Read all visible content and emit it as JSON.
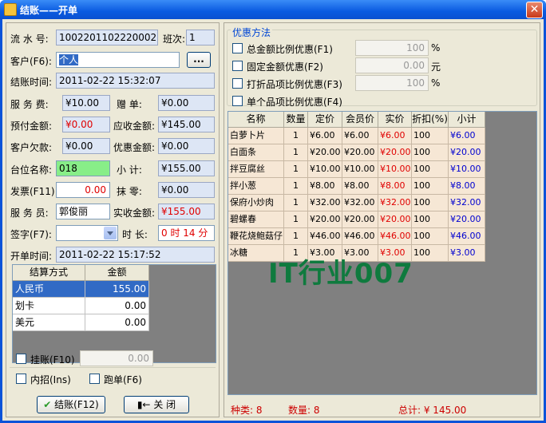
{
  "window": {
    "title": "结账——开单"
  },
  "left": {
    "serial_label": "流 水 号:",
    "serial_value": "1002201102220002",
    "shift_label": "班次:",
    "shift_value": "1",
    "customer_label": "客户(F6):",
    "customer_value": "个人",
    "customer_btn": "...",
    "checkout_time_label": "结账时间:",
    "checkout_time_value": "2011-02-22 15:32:07",
    "service_fee_label": "服 务 费:",
    "service_fee_value": "¥10.00",
    "gift_label": "赠    单:",
    "gift_value": "¥0.00",
    "prepaid_label": "预付金额:",
    "prepaid_value": "¥0.00",
    "receivable_label": "应收金额:",
    "receivable_value": "¥145.00",
    "owed_label": "客户欠款:",
    "owed_value": "¥0.00",
    "discount_label": "优惠金额:",
    "discount_value": "¥0.00",
    "table_label": "台位名称:",
    "table_value": "018",
    "subtotal_label": "小    计:",
    "subtotal_value": "¥155.00",
    "invoice_label": "发票(F11)",
    "invoice_value": "0.00",
    "rounding_label": "抹    零:",
    "rounding_value": "¥0.00",
    "waiter_label": "服 务 员:",
    "waiter_value": "郭俊丽",
    "actual_label": "实收金额:",
    "actual_value": "¥155.00",
    "sign_label": "签字(F7):",
    "sign_value": "",
    "duration_label": "时  长:",
    "duration_value": "0 时 14 分",
    "open_time_label": "开单时间:",
    "open_time_value": "2011-02-22 15:17:52"
  },
  "payment_grid": {
    "headers": [
      "结算方式",
      "金额"
    ],
    "rows": [
      {
        "method": "人民币",
        "amount": "155.00"
      },
      {
        "method": "划卡",
        "amount": "0.00"
      },
      {
        "method": "美元",
        "amount": "0.00"
      }
    ]
  },
  "options": {
    "hang_label": "挂账(F10)",
    "hang_value": "0.00",
    "internal_label": "内招(Ins)",
    "runaway_label": "跑单(F6)"
  },
  "buttons": {
    "checkout": "结账(F12)",
    "close": "关  闭"
  },
  "discount": {
    "group_title": "优惠方法",
    "items": [
      {
        "label": "总金额比例优惠(F1)",
        "value": "100",
        "unit": "%"
      },
      {
        "label": "固定金额优惠(F2)",
        "value": "0.00",
        "unit": "元"
      },
      {
        "label": "打折品项比例优惠(F3)",
        "value": "100",
        "unit": "%"
      },
      {
        "label": "单个品项比例优惠(F4)",
        "value": "",
        "unit": ""
      }
    ]
  },
  "items_grid": {
    "headers": [
      "名称",
      "数量",
      "定价",
      "会员价",
      "实价",
      "折扣(%)",
      "小计"
    ],
    "rows": [
      [
        "白萝卜片",
        "1",
        "¥6.00",
        "¥6.00",
        "¥6.00",
        "100",
        "¥6.00"
      ],
      [
        "白面条",
        "1",
        "¥20.00",
        "¥20.00",
        "¥20.00",
        "100",
        "¥20.00"
      ],
      [
        "拌豆腐丝",
        "1",
        "¥10.00",
        "¥10.00",
        "¥10.00",
        "100",
        "¥10.00"
      ],
      [
        "拌小葱",
        "1",
        "¥8.00",
        "¥8.00",
        "¥8.00",
        "100",
        "¥8.00"
      ],
      [
        "保府小炒肉",
        "1",
        "¥32.00",
        "¥32.00",
        "¥32.00",
        "100",
        "¥32.00"
      ],
      [
        "碧螺春",
        "1",
        "¥20.00",
        "¥20.00",
        "¥20.00",
        "100",
        "¥20.00"
      ],
      [
        "鞭花烧鲍菇仔",
        "1",
        "¥46.00",
        "¥46.00",
        "¥46.00",
        "100",
        "¥46.00"
      ],
      [
        "冰糖",
        "1",
        "¥3.00",
        "¥3.00",
        "¥3.00",
        "100",
        "¥3.00"
      ]
    ]
  },
  "watermark": "IT行业007",
  "footer": {
    "kinds": "种类: 8",
    "quantity": "数量: 8",
    "total": "总计: ¥ 145.00"
  }
}
